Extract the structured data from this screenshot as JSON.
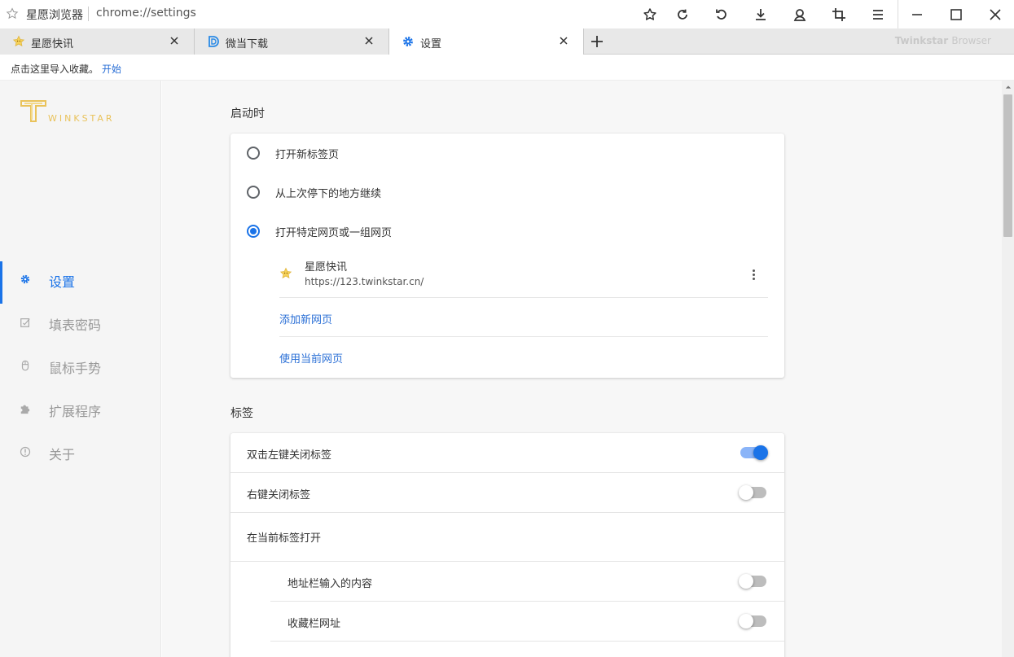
{
  "window": {
    "app_name": "星愿浏览器",
    "url": "chrome://settings"
  },
  "tabs": [
    {
      "label": "星愿快讯",
      "icon": "star-face-icon",
      "active": false
    },
    {
      "label": "微当下载",
      "icon": "d-logo-icon",
      "active": false
    },
    {
      "label": "设置",
      "icon": "gear-icon",
      "active": true
    }
  ],
  "tabstrip_brand": {
    "bold": "Twinkstar",
    "light": "Browser"
  },
  "bookmark_bar": {
    "message": "点击这里导入收藏。",
    "start_link": "开始"
  },
  "sidebar": {
    "logo_text": "WINKSTAR",
    "items": [
      {
        "label": "设置",
        "icon": "gear-icon",
        "active": true
      },
      {
        "label": "填表密码",
        "icon": "form-icon",
        "active": false
      },
      {
        "label": "鼠标手势",
        "icon": "mouse-icon",
        "active": false
      },
      {
        "label": "扩展程序",
        "icon": "puzzle-icon",
        "active": false
      },
      {
        "label": "关于",
        "icon": "info-icon",
        "active": false
      }
    ]
  },
  "startup": {
    "title": "启动时",
    "options": [
      {
        "label": "打开新标签页",
        "checked": false
      },
      {
        "label": "从上次停下的地方继续",
        "checked": false
      },
      {
        "label": "打开特定网页或一组网页",
        "checked": true
      }
    ],
    "page": {
      "name": "星愿快讯",
      "url": "https://123.twinkstar.cn/"
    },
    "add_page": "添加新网页",
    "use_current": "使用当前网页"
  },
  "tabs_section": {
    "title": "标签",
    "double_click_close": {
      "label": "双击左键关闭标签",
      "on": true
    },
    "right_click_close": {
      "label": "右键关闭标签",
      "on": false
    },
    "open_in_current": "在当前标签打开",
    "address_input": {
      "label": "地址栏输入的内容",
      "on": false
    },
    "bookmark_url": {
      "label": "收藏栏网址",
      "on": false
    }
  },
  "colors": {
    "accent": "#1a73e8",
    "link": "#2a6fd6",
    "logo": "#e9c25a"
  }
}
